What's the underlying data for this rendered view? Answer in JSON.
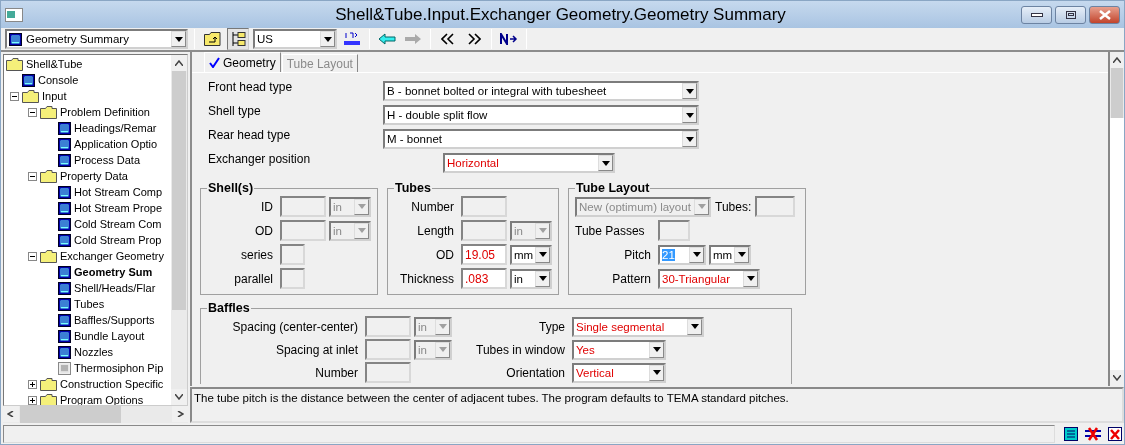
{
  "window": {
    "title": "Shell&Tube.Input.Exchanger Geometry.Geometry Summary"
  },
  "toolbar": {
    "navigator": "Geometry Summary",
    "units": "US",
    "tree_toggle_pressed": true,
    "forward_disabled": true
  },
  "tree": [
    {
      "label": "Shell&Tube",
      "kind": "folder",
      "selected": false,
      "children": [
        {
          "label": "Console",
          "kind": "form",
          "selected": false
        },
        {
          "label": "Input",
          "kind": "folder",
          "expanded": true,
          "selected": false,
          "children": [
            {
              "label": "Problem Definition",
              "kind": "folder",
              "expanded": true,
              "selected": false,
              "children": [
                {
                  "label": "Headings/Remar",
                  "kind": "form",
                  "selected": false
                },
                {
                  "label": "Application Optio",
                  "kind": "form",
                  "selected": false
                },
                {
                  "label": "Process Data",
                  "kind": "form",
                  "selected": false
                }
              ]
            },
            {
              "label": "Property Data",
              "kind": "folder",
              "expanded": true,
              "selected": false,
              "children": [
                {
                  "label": "Hot Stream Comp",
                  "kind": "form",
                  "selected": false
                },
                {
                  "label": "Hot Stream Prope",
                  "kind": "form",
                  "selected": false
                },
                {
                  "label": "Cold Stream Com",
                  "kind": "form",
                  "selected": false
                },
                {
                  "label": "Cold Stream Prop",
                  "kind": "form",
                  "selected": false
                }
              ]
            },
            {
              "label": "Exchanger Geometry",
              "kind": "folder",
              "expanded": true,
              "selected": false,
              "children": [
                {
                  "label": "Geometry Sum",
                  "kind": "form",
                  "selected": true
                },
                {
                  "label": "Shell/Heads/Flar",
                  "kind": "form",
                  "selected": false
                },
                {
                  "label": "Tubes",
                  "kind": "form",
                  "selected": false
                },
                {
                  "label": "Baffles/Supports",
                  "kind": "form",
                  "selected": false
                },
                {
                  "label": "Bundle Layout",
                  "kind": "form",
                  "selected": false
                },
                {
                  "label": "Nozzles",
                  "kind": "form",
                  "selected": false
                },
                {
                  "label": "Thermosiphon Pip",
                  "kind": "form-disabled",
                  "selected": false
                }
              ]
            },
            {
              "label": "Construction Specific",
              "kind": "folder",
              "expanded": false,
              "selected": false
            },
            {
              "label": "Program Options",
              "kind": "folder",
              "expanded": false,
              "selected": false
            }
          ]
        }
      ]
    }
  ],
  "tabs": [
    {
      "label": "Geometry",
      "selected": true,
      "complete": true
    },
    {
      "label": "Tube Layout",
      "selected": false,
      "complete": false
    }
  ],
  "head_rows": [
    {
      "label": "Front head type",
      "value": "B - bonnet bolted or integral with tubesheet",
      "default": false
    },
    {
      "label": "Shell type",
      "value": "H - double split flow",
      "default": false
    },
    {
      "label": "Rear head type",
      "value": "M - bonnet",
      "default": false
    },
    {
      "label": "Exchanger position",
      "value": "Horizontal",
      "default": true
    }
  ],
  "groups": [
    {
      "title": "Shell(s)",
      "rows": [
        {
          "label": "ID",
          "field": {
            "disabled": true
          },
          "unit": {
            "value": "in",
            "disabled": true
          }
        },
        {
          "label": "OD",
          "field": {
            "disabled": true
          },
          "unit": {
            "value": "in",
            "disabled": true
          }
        },
        {
          "label": "series",
          "field": {
            "disabled": true,
            "small": true
          }
        },
        {
          "label": "parallel",
          "field": {
            "disabled": true,
            "small": true
          }
        }
      ]
    },
    {
      "title": "Tubes",
      "rows": [
        {
          "label": "Number",
          "field": {
            "disabled": true
          }
        },
        {
          "label": "Length",
          "field": {
            "disabled": true
          },
          "unit": {
            "value": "in",
            "disabled": true
          }
        },
        {
          "label": "OD",
          "field": {
            "value": "19.05",
            "disabled": false,
            "default": true
          },
          "unit": {
            "value": "mm",
            "disabled": false
          }
        },
        {
          "label": "Thickness",
          "field": {
            "value": ".083",
            "disabled": false,
            "default": true
          },
          "unit": {
            "value": "in",
            "disabled": false
          }
        }
      ]
    }
  ],
  "tube_layout": {
    "title": "Tube Layout",
    "layout": {
      "value": "New (optimum) layout",
      "disabled": true
    },
    "tubes_label": "Tubes:",
    "passes_label": "Tube Passes",
    "pitch": {
      "label": "Pitch",
      "value": "21",
      "highlighted": true,
      "unit": "mm"
    },
    "pattern": {
      "label": "Pattern",
      "value": "30-Triangular",
      "default": true
    }
  },
  "baffles": {
    "title": "Baffles",
    "left": [
      {
        "label": "Spacing (center-center)",
        "unit": "in"
      },
      {
        "label": "Spacing at inlet",
        "unit": "in"
      },
      {
        "label": "Number"
      }
    ],
    "right": [
      {
        "label": "Type",
        "value": "Single segmental",
        "default": true
      },
      {
        "label": "Tubes in window",
        "value": "Yes",
        "default": true
      },
      {
        "label": "Orientation",
        "value": "Vertical",
        "default": true
      }
    ]
  },
  "help_text": "The tube pitch is the distance between the center of adjacent tubes. The program defaults to TEMA standard pitches."
}
